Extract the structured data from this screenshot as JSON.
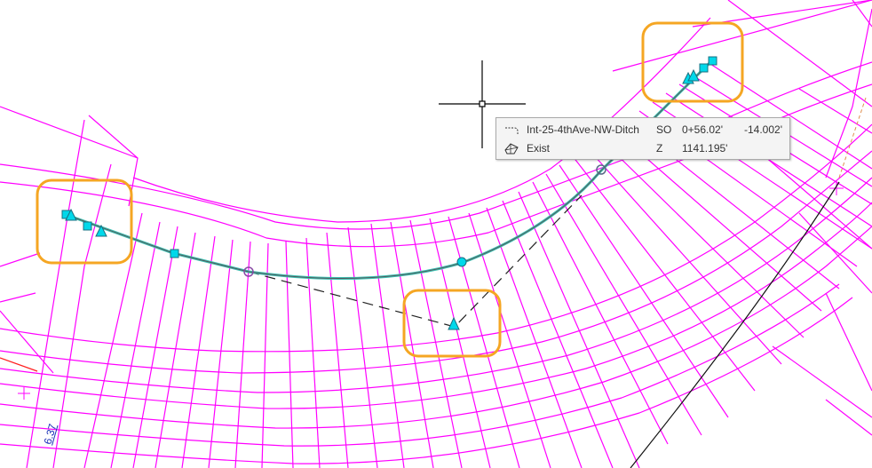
{
  "canvas": {
    "colors": {
      "grid": "#ff00ff",
      "alignment": "#3bbfb1",
      "grip": "#00d8ea",
      "grip_stroke": "#1a6f80",
      "highlight_box": "#f5a623",
      "crosshair": "#000000",
      "dashed_link": "#222222"
    }
  },
  "tooltip": {
    "row1": {
      "icon": "alignment-line-icon",
      "name": "Int-25-4thAve-NW-Ditch",
      "code": "SO",
      "station": "0+56.02'",
      "offset": "-14.002'"
    },
    "row2": {
      "icon": "surface-icon",
      "name": "Exist",
      "code": "Z",
      "elevation": "1141.195'"
    }
  },
  "station_label": "6.37"
}
